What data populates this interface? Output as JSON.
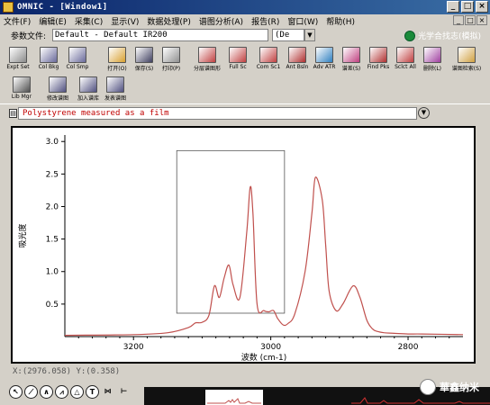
{
  "window": {
    "title": "OMNIC - [Window1]",
    "btn_min": "_",
    "btn_max": "□",
    "btn_close": "×"
  },
  "menu": [
    "文件(F)",
    "编辑(E)",
    "采集(C)",
    "显示(V)",
    "数据处理(P)",
    "谱图分析(A)",
    "报告(R)",
    "窗口(W)",
    "帮助(H)"
  ],
  "mdi_buttons": [
    "_",
    "□",
    "×"
  ],
  "params": {
    "label": "参数文件:",
    "value": "Default - Default IR200",
    "extra": "(De",
    "brand": "光学合找志(模拟)"
  },
  "toolbar": [
    {
      "label": "Expt Set",
      "icon": "experiment-setup-icon",
      "color": "#8a8a8a"
    },
    {
      "label": "Col Bkg",
      "icon": "collect-background-icon",
      "color": "#6a6a9a"
    },
    {
      "label": "Col Smp",
      "icon": "collect-sample-icon",
      "color": "#6a6a9a"
    },
    {
      "label": "打开(O)",
      "icon": "open-folder-icon",
      "color": "#d8a030"
    },
    {
      "label": "保存(S)",
      "icon": "save-disk-icon",
      "color": "#404060"
    },
    {
      "label": "打印(P)",
      "icon": "printer-icon",
      "color": "#909090"
    },
    {
      "label": "分层谱图形",
      "icon": "stack-spectra-icon",
      "color": "#c04040"
    },
    {
      "label": "Full Sc",
      "icon": "full-scale-icon",
      "color": "#c04040"
    },
    {
      "label": "Com Sc1",
      "icon": "common-scale-icon",
      "color": "#c04040"
    },
    {
      "label": "Ant Bsln",
      "icon": "auto-baseline-icon",
      "color": "#b03030"
    },
    {
      "label": "Adv ATR",
      "icon": "advanced-atr-icon",
      "color": "#3080c0"
    },
    {
      "label": "谱差(S)",
      "icon": "subtract-icon",
      "color": "#c04080"
    },
    {
      "label": "Find Pks",
      "icon": "find-peaks-icon",
      "color": "#b03030"
    },
    {
      "label": "Sclct All",
      "icon": "select-all-icon",
      "color": "#c04040"
    },
    {
      "label": "删除(L)",
      "icon": "delete-icon",
      "color": "#a040a0"
    },
    {
      "label": "谱图检索(S)",
      "icon": "search-library-icon",
      "color": "#d0a040"
    },
    {
      "label": "Lib Mgr",
      "icon": "library-manager-icon",
      "color": "#505050"
    },
    {
      "label": "修改谱图",
      "icon": "modify-spectrum-icon",
      "color": "#505080"
    },
    {
      "label": "加入谱库",
      "icon": "add-to-library-icon",
      "color": "#505080"
    },
    {
      "label": "发表谱图",
      "icon": "publish-spectrum-icon",
      "color": "#505080"
    }
  ],
  "spectrum_title": "Polystyrene measured as a film",
  "coord": "X:(2976.058) Y:(0.358)",
  "watermark": "華鑫纳米",
  "chart_data": {
    "type": "line",
    "title": "",
    "xlabel": "波数 (cm-1)",
    "ylabel": "吸光度",
    "xlim": [
      3300,
      2720
    ],
    "ylim": [
      0.0,
      3.1
    ],
    "x_ticks": [
      3200,
      3000,
      2800
    ],
    "y_ticks": [
      0.5,
      1.0,
      1.5,
      2.0,
      2.5,
      3.0
    ],
    "x_tick_labels": [
      "3200",
      "3000",
      "2800"
    ],
    "y_tick_labels": [
      "0.5",
      "1.0",
      "1.5",
      "2.0",
      "2.5",
      "3.0"
    ],
    "grid": false,
    "selection_box": {
      "x_from": 3137,
      "x_to": 2980,
      "y_from": 0.36,
      "y_to": 2.86
    },
    "series": [
      {
        "color": "#c0504d",
        "x": [
          3300,
          3200,
          3150,
          3120,
          3110,
          3100,
          3090,
          3082,
          3075,
          3068,
          3061,
          3055,
          3045,
          3035,
          3030,
          3026,
          3020,
          3010,
          3003,
          2996,
          2990,
          2982,
          2975,
          2965,
          2950,
          2940,
          2935,
          2925,
          2920,
          2915,
          2905,
          2895,
          2880,
          2870,
          2860,
          2852,
          2845,
          2835,
          2820,
          2800,
          2780,
          2720
        ],
        "y": [
          0.02,
          0.03,
          0.06,
          0.14,
          0.21,
          0.22,
          0.33,
          0.78,
          0.6,
          0.9,
          1.1,
          0.8,
          0.6,
          1.6,
          2.3,
          1.9,
          0.5,
          0.4,
          0.38,
          0.4,
          0.28,
          0.18,
          0.2,
          0.35,
          1.0,
          1.9,
          2.45,
          2.1,
          1.4,
          0.7,
          0.4,
          0.5,
          0.78,
          0.6,
          0.25,
          0.12,
          0.08,
          0.06,
          0.05,
          0.04,
          0.04,
          0.03
        ]
      }
    ]
  }
}
